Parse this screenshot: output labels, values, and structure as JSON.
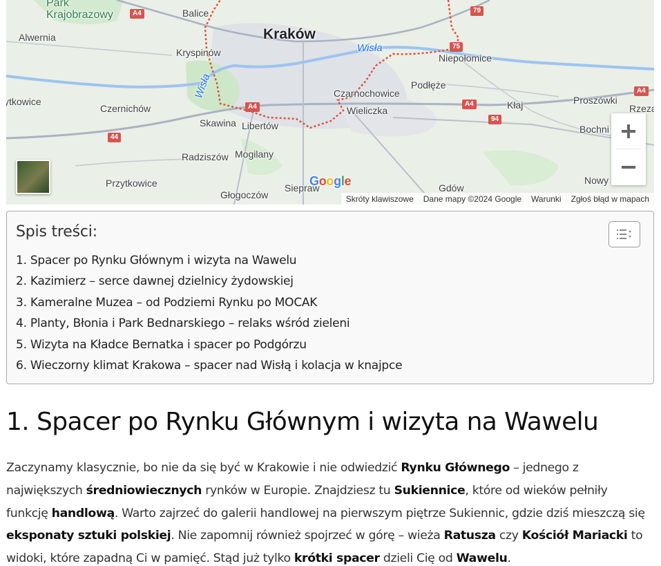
{
  "map": {
    "labels": {
      "park_krajobrazowy": "Park\nKrajobrazowy",
      "alwernia": "Alwernia",
      "balice": "Balice",
      "krakow": "Kraków",
      "kryspinow": "Kryspinów",
      "wisla_east": "Wisła",
      "wisla_west": "Wisła",
      "niepolomice": "Niepołomice",
      "podleze": "Podłęże",
      "czarnochowice": "Czarnochowice",
      "ytkowice": "ytkowice",
      "czernichow": "Czernichów",
      "wieliczka": "Wieliczka",
      "klaj": "Kłaj",
      "proszowki": "Proszówki",
      "rzeza": "Rzeza",
      "skawina": "Skawina",
      "libertow": "Libertów",
      "bochnia": "Bochni",
      "radziszow": "Radziszów",
      "mogilany": "Mogilany",
      "przytkowice": "Przytkowice",
      "siepraw": "Siepraw",
      "gdow": "Gdów",
      "nowy": "Nowy",
      "glogoczow": "Głogoczów"
    },
    "road_shields": {
      "a4_top": "A4",
      "r79": "79",
      "r75": "75",
      "a4_right": "A4",
      "a4_center": "A4",
      "a4_east": "A4",
      "r94": "94",
      "r44": "44"
    },
    "google_logo": "Google",
    "attribution": [
      "Skróty klawiszowe",
      "Dane mapy ©2024 Google",
      "Warunki",
      "Zgłoś błąd w mapach"
    ],
    "zoom_in_label": "+",
    "zoom_out_label": "−",
    "colors": {
      "roads": "#8d99ab",
      "boundary": "#e0533d",
      "river": "#8ab4f8",
      "urban": "#dcdfe3",
      "green": "#cbe6c6",
      "shield": "#d9534f"
    }
  },
  "toc": {
    "title": "Spis treści:",
    "items": [
      "1. Spacer po Rynku Głównym i wizyta na Wawelu",
      "2. Kazimierz – serce dawnej dzielnicy żydowskiej",
      "3. Kameralne Muzea – od Podziemi Rynku po MOCAK",
      "4. Planty, Błonia i Park Bednarskiego – relaks wśród zieleni",
      "5. Wizyta na Kładce Bernatka i spacer po Podgórzu",
      "6. Wieczorny klimat Krakowa – spacer nad Wisłą i kolacja w knajpce"
    ]
  },
  "article": {
    "heading": "1. Spacer po Rynku Głównym i wizyta na Wawelu",
    "p": {
      "t1": "Zaczynamy klasycznie, bo nie da się być w Krakowie i nie odwiedzić ",
      "b1": "Rynku Głównego",
      "t2": " – jednego z największych ",
      "b2": "średniowiecznych",
      "t3": " rynków w Europie. Znajdziesz tu ",
      "b3": "Sukiennice",
      "t4": ", które od wieków pełniły funkcję ",
      "b4": "handlową",
      "t5": ". Warto zajrzeć do galerii handlowej na pierwszym piętrze Sukiennic, gdzie dziś mieszczą się ",
      "b5": "eksponaty sztuki polskiej",
      "t6": ". Nie zapomnij również spojrzeć w górę – wieża ",
      "b6": "Ratusza",
      "t7": " czy ",
      "b7": "Kościół Mariacki",
      "t8": " to widoki, które zapadną Ci w pamięć. Stąd już tylko ",
      "b8": "krótki spacer",
      "t9": " dzieli Cię od ",
      "b9": "Wawelu",
      "t10": "."
    }
  }
}
